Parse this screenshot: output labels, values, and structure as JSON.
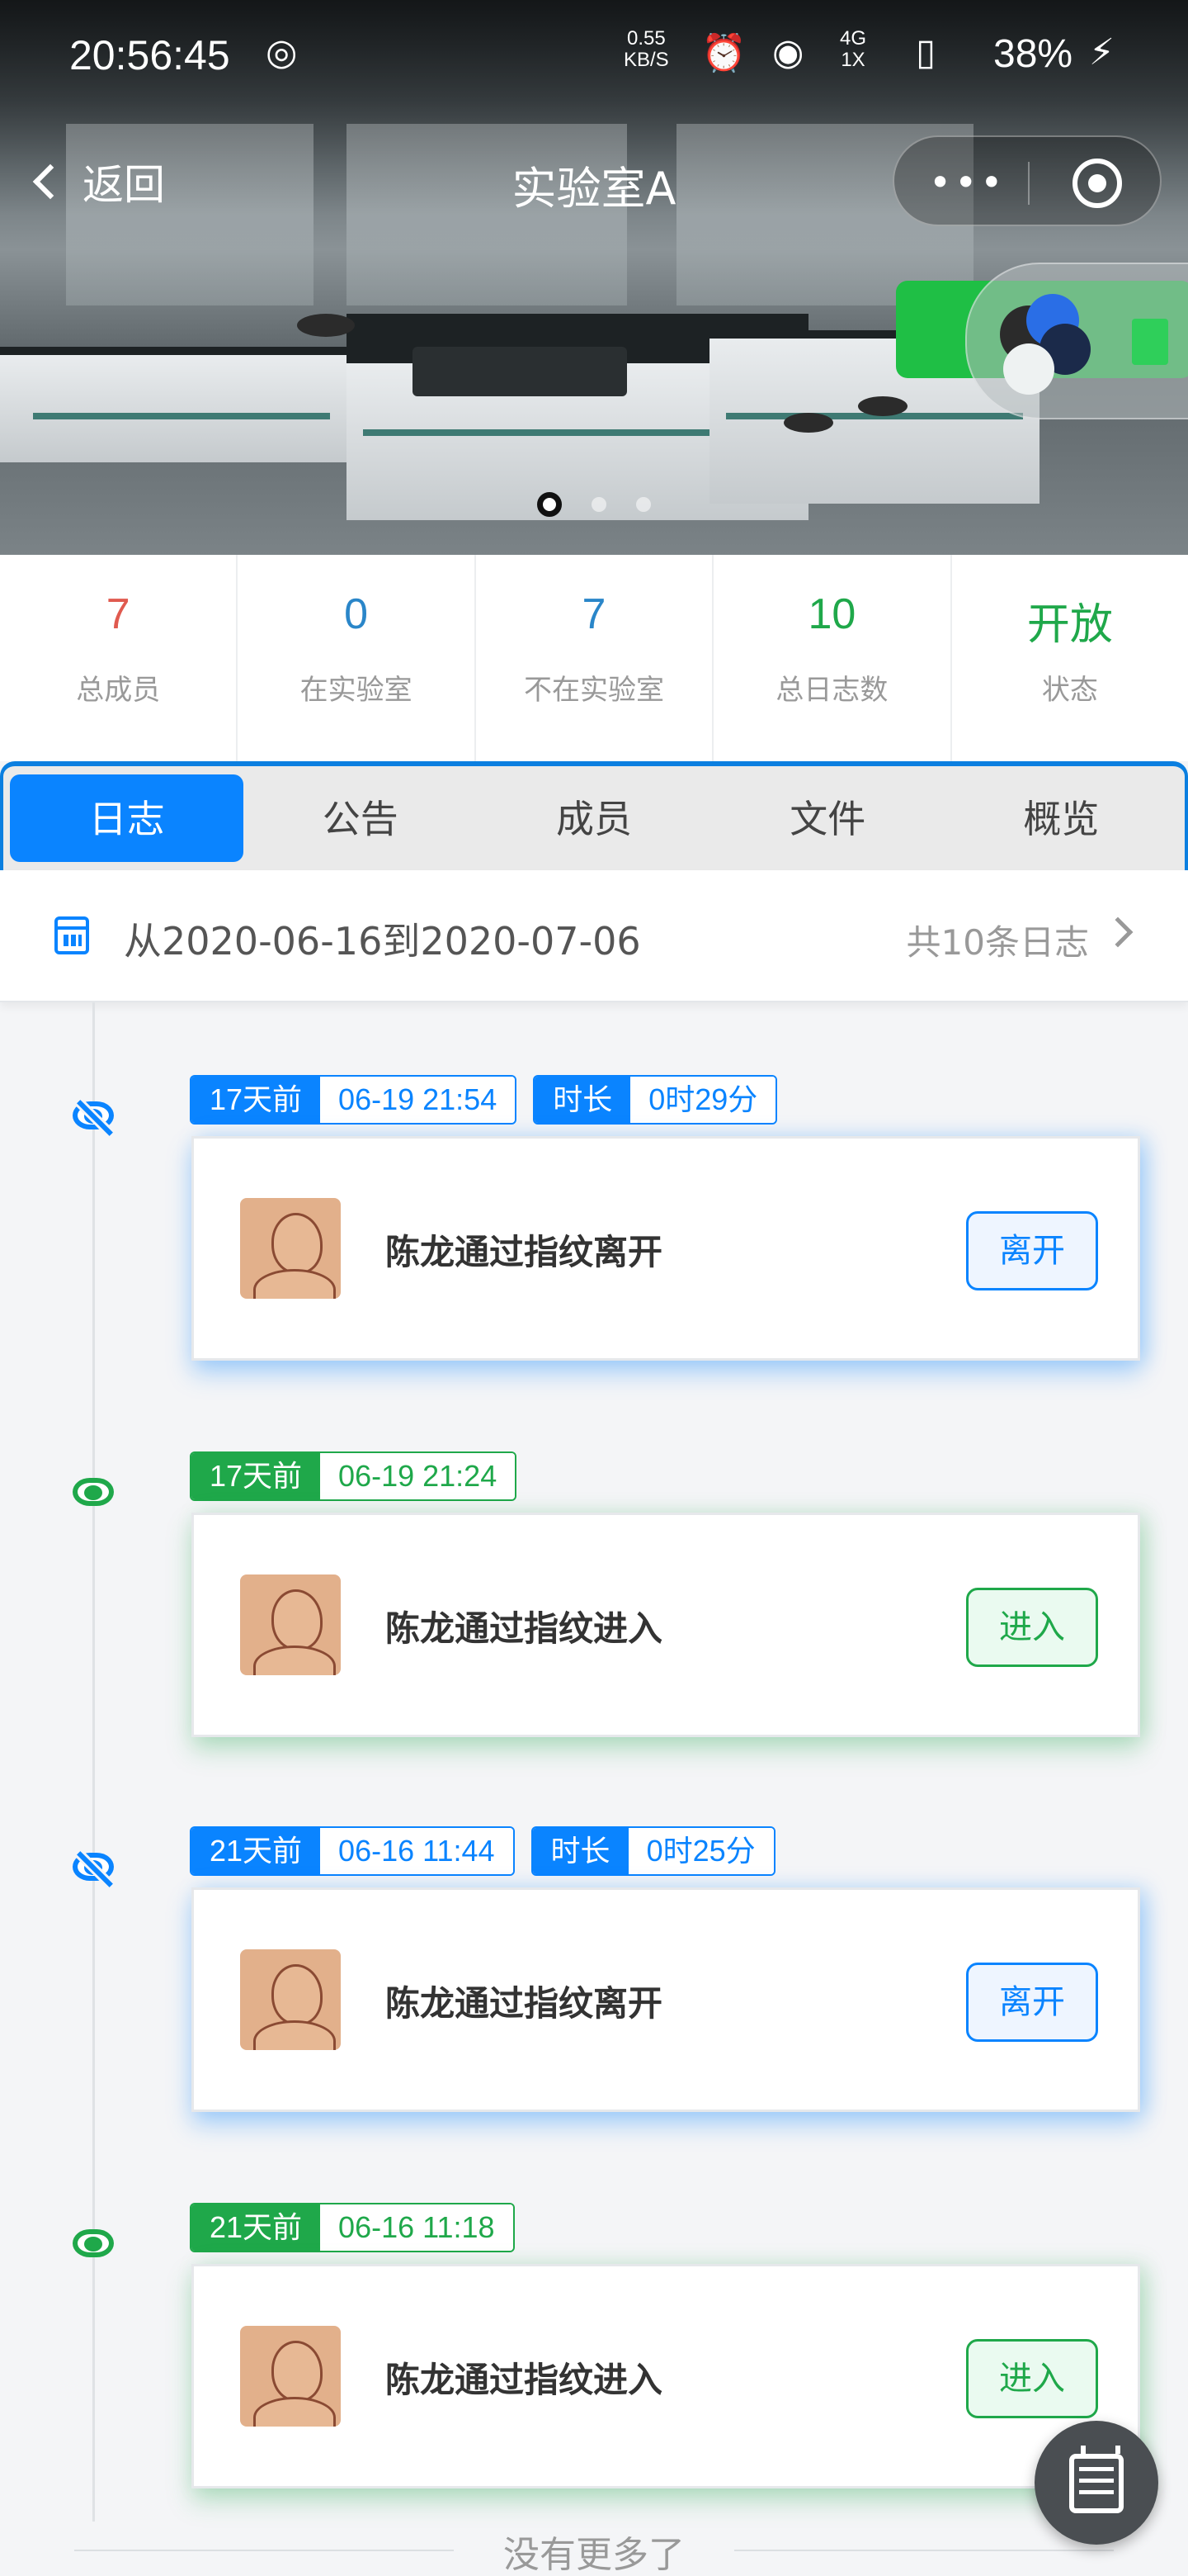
{
  "statusbar": {
    "time": "20:56:45",
    "net_speed_value": "0.55",
    "net_speed_unit": "KB/S",
    "network": "4G",
    "network2": "1X",
    "battery": "38%"
  },
  "navbar": {
    "back_label": "返回",
    "title": "实验室A",
    "menu_dots": "•••"
  },
  "carousel": {
    "pages": 3,
    "active": 0
  },
  "stats": [
    {
      "value": "7",
      "label": "总成员",
      "color": "#e05a4f"
    },
    {
      "value": "0",
      "label": "在实验室",
      "color": "#2a86c9"
    },
    {
      "value": "7",
      "label": "不在实验室",
      "color": "#2a86c9"
    },
    {
      "value": "10",
      "label": "总日志数",
      "color": "#1fa84a"
    },
    {
      "value": "开放",
      "label": "状态",
      "color": "#1fa84a"
    }
  ],
  "tabs": [
    "日志",
    "公告",
    "成员",
    "文件",
    "概览"
  ],
  "range": {
    "text": "从2020-06-16到2020-07-06",
    "count": "共10条日志"
  },
  "entries": [
    {
      "ago": "17天前",
      "datetime": "06-19 21:54",
      "duration_label": "时长",
      "duration": "0时29分",
      "message": "陈龙通过指纹离开",
      "action": "离开",
      "kind": "leave"
    },
    {
      "ago": "17天前",
      "datetime": "06-19 21:24",
      "message": "陈龙通过指纹进入",
      "action": "进入",
      "kind": "enter"
    },
    {
      "ago": "21天前",
      "datetime": "06-16 11:44",
      "duration_label": "时长",
      "duration": "0时25分",
      "message": "陈龙通过指纹离开",
      "action": "离开",
      "kind": "leave"
    },
    {
      "ago": "21天前",
      "datetime": "06-16 11:18",
      "message": "陈龙通过指纹进入",
      "action": "进入",
      "kind": "enter"
    }
  ],
  "footer": {
    "no_more": "没有更多了"
  },
  "colors": {
    "primary": "#0a84ff",
    "green": "#1fa84a"
  }
}
